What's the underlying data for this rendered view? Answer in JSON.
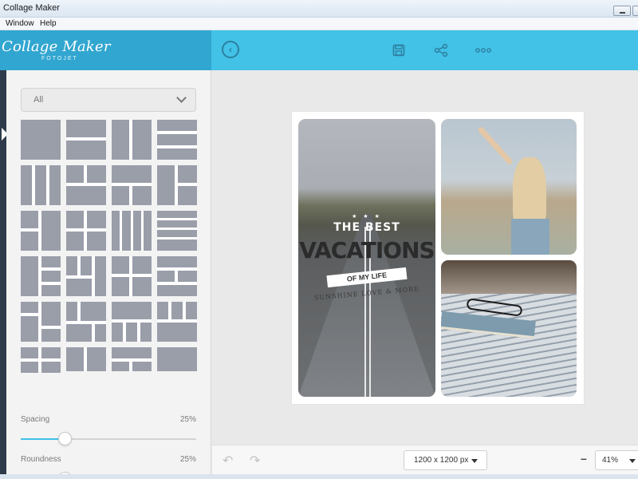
{
  "window": {
    "title": "Collage Maker",
    "menu": [
      "Window",
      "Help"
    ]
  },
  "brand": {
    "logo": "Collage Maker",
    "sublogo": "FOTOJET"
  },
  "toolbar": {
    "back_icon": "back-circle-icon",
    "save_icon": "save-icon",
    "share_icon": "share-icon",
    "more_icon": "more-icon"
  },
  "sidebar": {
    "filter": {
      "value": "All"
    },
    "spacing": {
      "label": "Spacing",
      "value_text": "25%",
      "value": 0.25
    },
    "roundness": {
      "label": "Roundness",
      "value_text": "25%",
      "value": 0.25
    }
  },
  "collage": {
    "text": {
      "stars": "★ ★ ★",
      "line1": "THE BEST",
      "line2": "VACATIONS",
      "line3": "OF MY LIFE",
      "line4": "SUNSHINE LOVE & MORE"
    },
    "photos": [
      "road",
      "girl",
      "book"
    ]
  },
  "bottombar": {
    "size": "1200 x 1200 px",
    "zoom": "41%"
  },
  "colors": {
    "accent": "#41c2e6",
    "brand": "#31a6d0",
    "cell": "#9a9ea9"
  }
}
